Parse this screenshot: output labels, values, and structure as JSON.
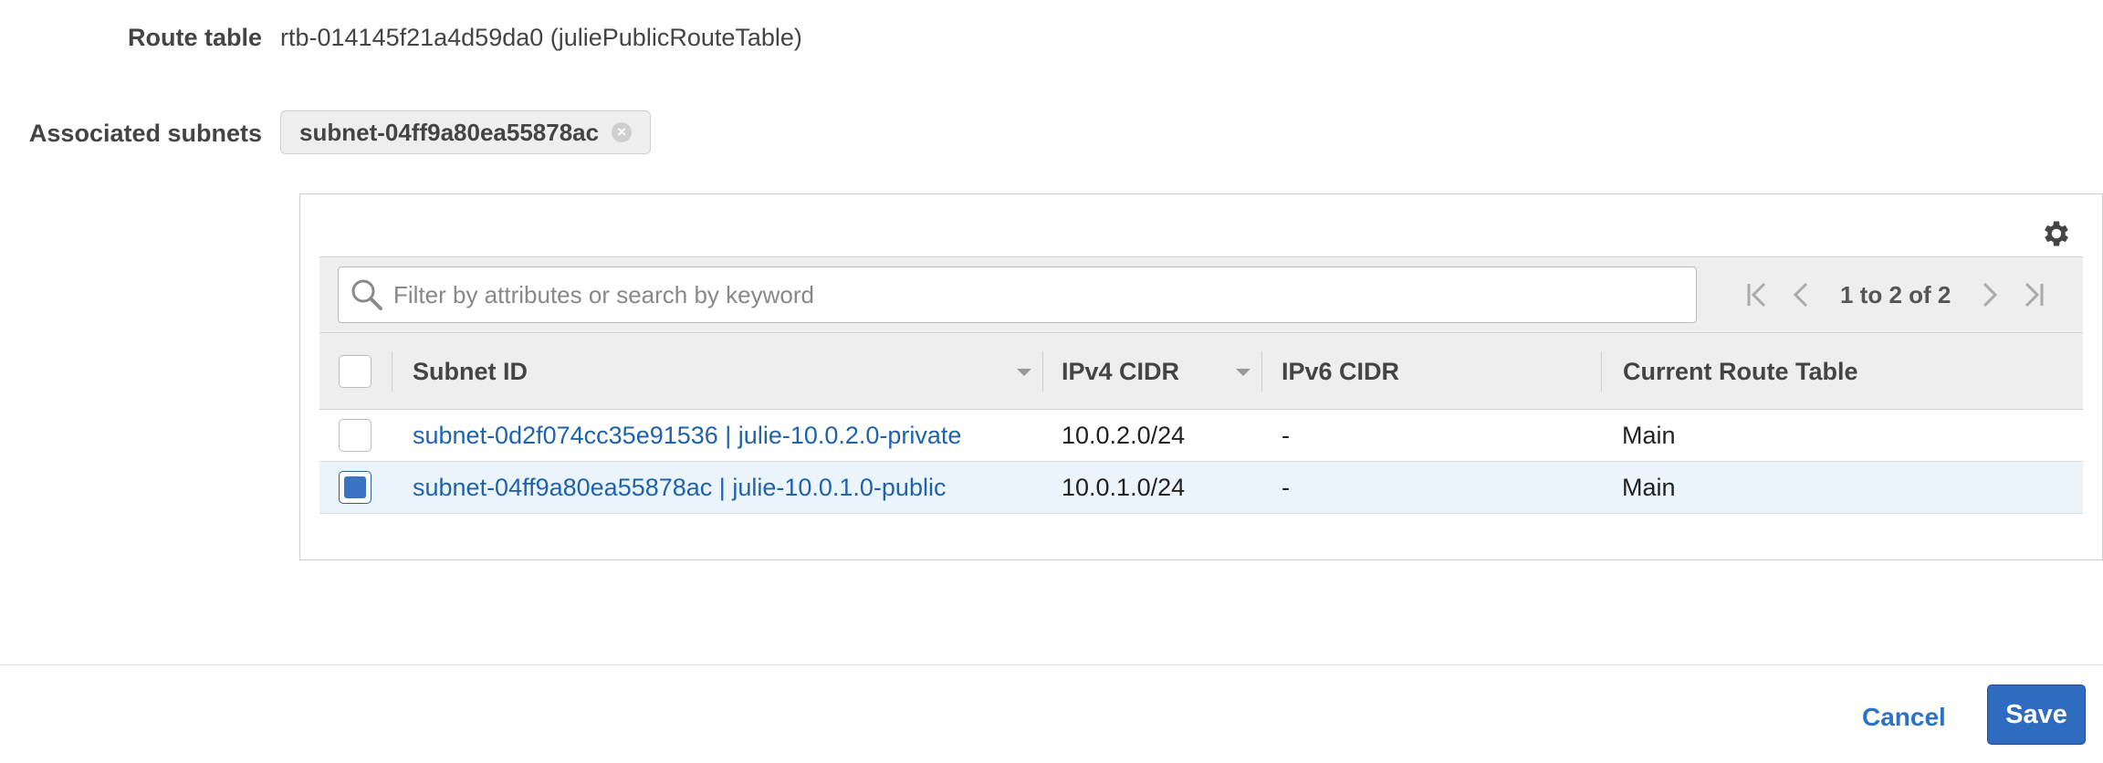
{
  "route_table": {
    "label": "Route table",
    "value": "rtb-014145f21a4d59da0 (juliePublicRouteTable)"
  },
  "associated_subnets": {
    "label": "Associated subnets",
    "chips": [
      {
        "label": "subnet-04ff9a80ea55878ac",
        "remove_icon": "close-circle-icon"
      }
    ]
  },
  "panel": {
    "settings_icon": "gear-icon",
    "search": {
      "placeholder": "Filter by attributes or search by keyword",
      "value": "",
      "icon": "search-icon"
    },
    "pager": {
      "range_text": "1 to 2 of 2",
      "icons": [
        "first-page-icon",
        "prev-page-icon",
        "next-page-icon",
        "last-page-icon"
      ]
    },
    "columns": [
      "Subnet ID",
      "IPv4 CIDR",
      "IPv6 CIDR",
      "Current Route Table"
    ],
    "rows": [
      {
        "checked": false,
        "subnet_id": "subnet-0d2f074cc35e91536 | julie-10.0.2.0-private",
        "ipv4": "10.0.2.0/24",
        "ipv6": "-",
        "route_table": "Main"
      },
      {
        "checked": true,
        "subnet_id": "subnet-04ff9a80ea55878ac | julie-10.0.1.0-public",
        "ipv4": "10.0.1.0/24",
        "ipv6": "-",
        "route_table": "Main"
      }
    ]
  },
  "actions": {
    "cancel": "Cancel",
    "save": "Save"
  },
  "colors": {
    "link": "#1f63ad",
    "primary_button": "#2f6cc0",
    "selected_row": "#ebf3fb",
    "header_bg": "#eeeeee"
  }
}
